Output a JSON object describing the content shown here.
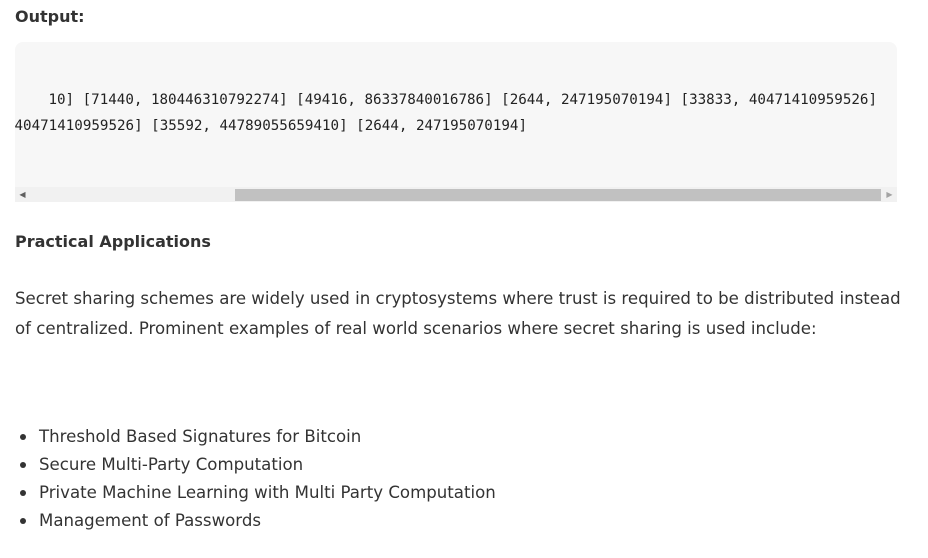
{
  "output": {
    "label": "Output:",
    "lines": [
      "10] [71440, 180446310792274] [49416, 86337840016786] [2644, 247195070194] [33833, 40471410959526]",
      "40471410959526] [35592, 44789055659410] [2644, 247195070194]"
    ]
  },
  "section": {
    "heading": "Practical Applications",
    "paragraph": "Secret sharing schemes are widely used in cryptosystems where trust is required to be distributed instead of centralized. Prominent examples of real world scenarios where secret sharing is used include:",
    "items": [
      "Threshold Based Signatures for Bitcoin",
      "Secure Multi-Party Computation",
      "Private Machine Learning with Multi Party Computation",
      "Management of Passwords"
    ]
  },
  "scrollbar": {
    "left_arrow": "◀",
    "right_arrow": "▶",
    "position_fraction": 0.25
  }
}
